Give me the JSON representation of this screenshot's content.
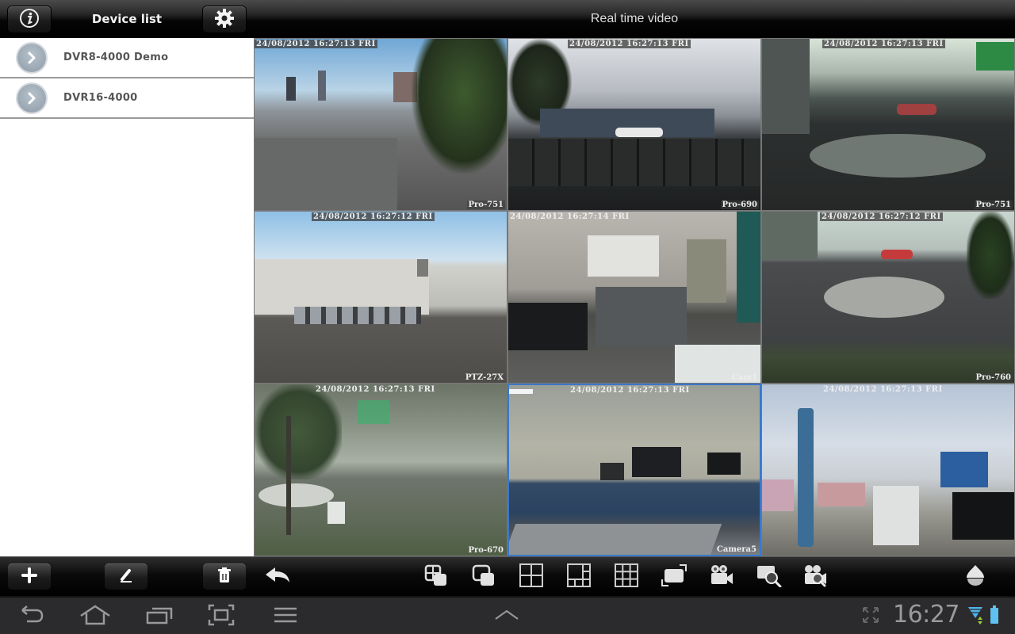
{
  "left_header": {
    "title": "Device list",
    "info_icon": "info-icon",
    "settings_icon": "gear-icon"
  },
  "right_header": {
    "title": "Real time video"
  },
  "devices": [
    {
      "label": "DVR8-4000 Demo",
      "icon": "chevron-right-circle-icon"
    },
    {
      "label": "DVR16-4000",
      "icon": "chevron-right-circle-icon"
    }
  ],
  "cameras": [
    {
      "timestamp": "24/08/2012 16:27:13 FRI",
      "name": "Pro-751",
      "scene": "city skyline rooftop"
    },
    {
      "timestamp": "24/08/2012 16:27:13 FRI",
      "name": "Pro-690",
      "scene": "truck behind fence"
    },
    {
      "timestamp": "24/08/2012 16:27:13 FRI",
      "name": "Pro-751",
      "scene": "roundabout with parked cars"
    },
    {
      "timestamp": "24/08/2012 16:27:12 FRI",
      "name": "PTZ-27X",
      "scene": "industrial parking lot"
    },
    {
      "timestamp": "24/08/2012 16:27:14 FRI",
      "name": "Cam1",
      "scene": "office with CRT monitor"
    },
    {
      "timestamp": "24/08/2012 16:27:12 FRI",
      "name": "Pro-760",
      "scene": "roundabout with garden"
    },
    {
      "timestamp": "24/08/2012 16:27:13 FRI",
      "name": "Pro-670",
      "scene": "trees and driveway"
    },
    {
      "timestamp": "24/08/2012 16:27:13 FRI",
      "name": "Camera5",
      "scene": "lab workbench",
      "selected": true
    },
    {
      "timestamp": "24/08/2012 16:27:13 FRI",
      "name": "",
      "scene": "open office"
    }
  ],
  "toolbar": {
    "left_buttons": [
      "add-icon",
      "edit-icon",
      "delete-icon",
      "back-arrow-icon"
    ],
    "view_buttons": [
      "single-view-layout-icon",
      "pip-layout-icon",
      "grid-4-icon",
      "grid-6-icon",
      "grid-9-icon",
      "fullscreen-icon",
      "record-camera-icon",
      "search-playback-icon",
      "camera-search-icon",
      "ptz-dome-icon"
    ]
  },
  "system_bar": {
    "nav_icons": [
      "back-icon",
      "home-icon",
      "recent-apps-icon",
      "screenshot-icon",
      "menu-icon"
    ],
    "center_icon": "chevron-up-icon",
    "time": "16:27",
    "status_icons": [
      "expand-icon",
      "wifi-icon",
      "battery-icon"
    ]
  },
  "colors": {
    "selected_border": "#3a78c8",
    "wifi": "#4fb3e8",
    "battery": "#5ec1f0"
  }
}
